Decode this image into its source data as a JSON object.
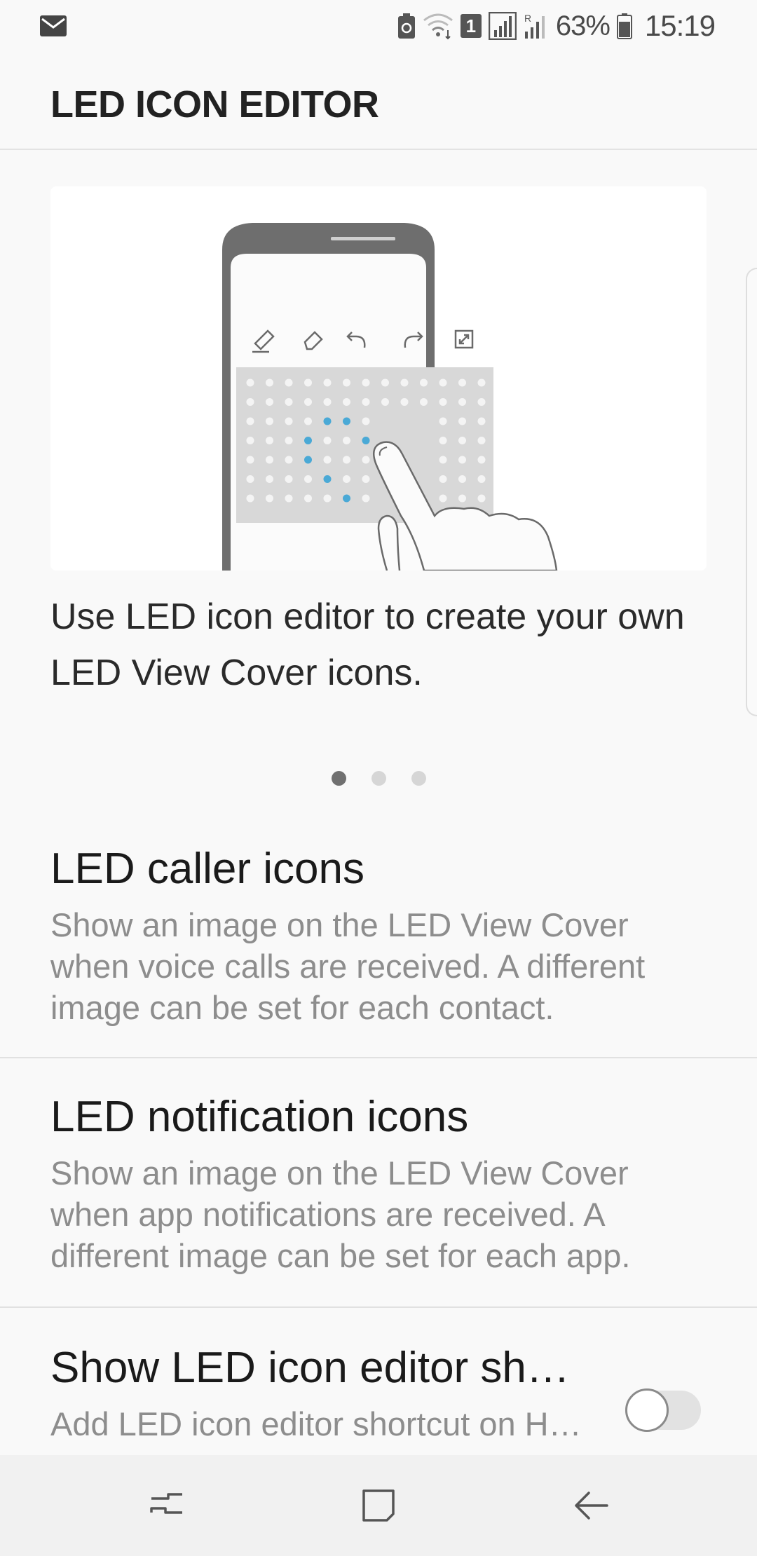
{
  "status_bar": {
    "battery_percent": "63%",
    "time": "15:19",
    "sim_badge": "1",
    "icons": [
      "mail-icon",
      "battery-saver-icon",
      "wifi-icon",
      "signal-icon",
      "battery-icon"
    ]
  },
  "app_bar": {
    "title": "LED ICON EDITOR"
  },
  "carousel": {
    "description": "Use LED icon editor to create your own LED View Cover icons.",
    "page_count": 3,
    "active_page": 1,
    "accent_color": "#4aa9d6"
  },
  "list": {
    "items": [
      {
        "title": "LED caller icons",
        "subtitle": "Show an image on the LED View Cover when voice calls are received. A different image can be set for each contact."
      },
      {
        "title": "LED notification icons",
        "subtitle": "Show an image on the LED View Cover when app notifications are received. A different image can be set for each app."
      },
      {
        "title": "Show LED icon editor sh…",
        "subtitle": "Add LED icon editor shortcut on H…",
        "toggle_on": false
      }
    ]
  },
  "nav_bar": {
    "buttons": [
      "recent-apps-icon",
      "home-icon",
      "back-icon"
    ]
  }
}
